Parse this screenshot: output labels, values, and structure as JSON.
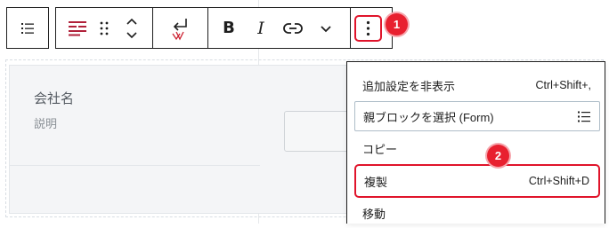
{
  "toolbar": {
    "buttons": [
      {
        "name": "list-view-button",
        "icon": "list-icon"
      },
      {
        "name": "block-type-button",
        "icon": "form-fields-icon"
      },
      {
        "name": "drag-handle",
        "icon": "drag-dots-icon"
      },
      {
        "name": "move-up-down",
        "icon": "chevron-updown-icon"
      },
      {
        "name": "select-parent-button",
        "icon": "return-arrow-icon"
      },
      {
        "name": "bold-button",
        "label": "B"
      },
      {
        "name": "italic-button",
        "label": "I"
      },
      {
        "name": "link-button",
        "icon": "link-icon"
      },
      {
        "name": "more-formats-button",
        "icon": "chevron-down-icon"
      },
      {
        "name": "options-button",
        "icon": "vertical-ellipsis-icon"
      }
    ],
    "bold_label": "B",
    "italic_label": "I"
  },
  "annotations": {
    "badge_1": "1",
    "badge_2": "2",
    "accent_color": "#e8202f"
  },
  "editor": {
    "field_label": "会社名",
    "field_description": "説明"
  },
  "menu": {
    "items": [
      {
        "label": "追加設定を非表示",
        "shortcut": "Ctrl+Shift+,"
      },
      {
        "label": "親ブロックを選択 (Form)",
        "icon": "list-icon"
      },
      {
        "label": "コピー"
      },
      {
        "label": "複製",
        "shortcut": "Ctrl+Shift+D"
      },
      {
        "label": "移動"
      }
    ]
  }
}
